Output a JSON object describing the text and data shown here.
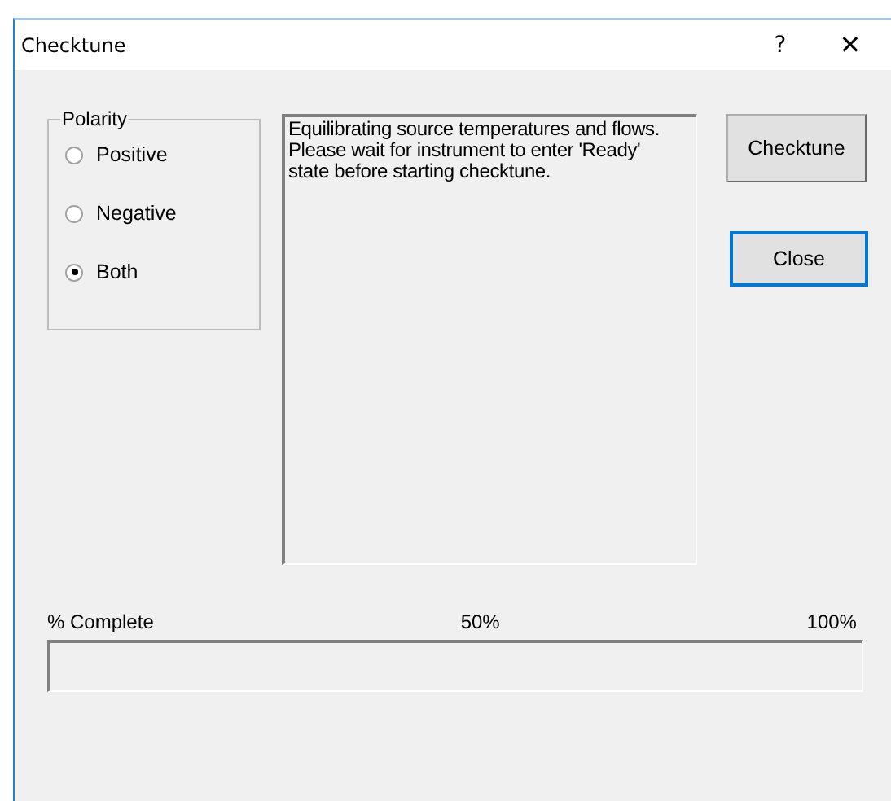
{
  "window": {
    "title": "Checktune",
    "help": "?",
    "close": "✕"
  },
  "polarity": {
    "title": "Polarity",
    "options": [
      {
        "label": "Positive",
        "selected": false
      },
      {
        "label": "Negative",
        "selected": false
      },
      {
        "label": "Both",
        "selected": true
      }
    ]
  },
  "message": "Equilibrating source temperatures and flows. Please wait for instrument to enter 'Ready' state before starting checktune.",
  "buttons": [
    {
      "label": "Checktune",
      "focused": false
    },
    {
      "label": "Close",
      "focused": true
    }
  ],
  "progress": {
    "labels": [
      "% Complete",
      "50%",
      "100%"
    ],
    "level": 0
  }
}
